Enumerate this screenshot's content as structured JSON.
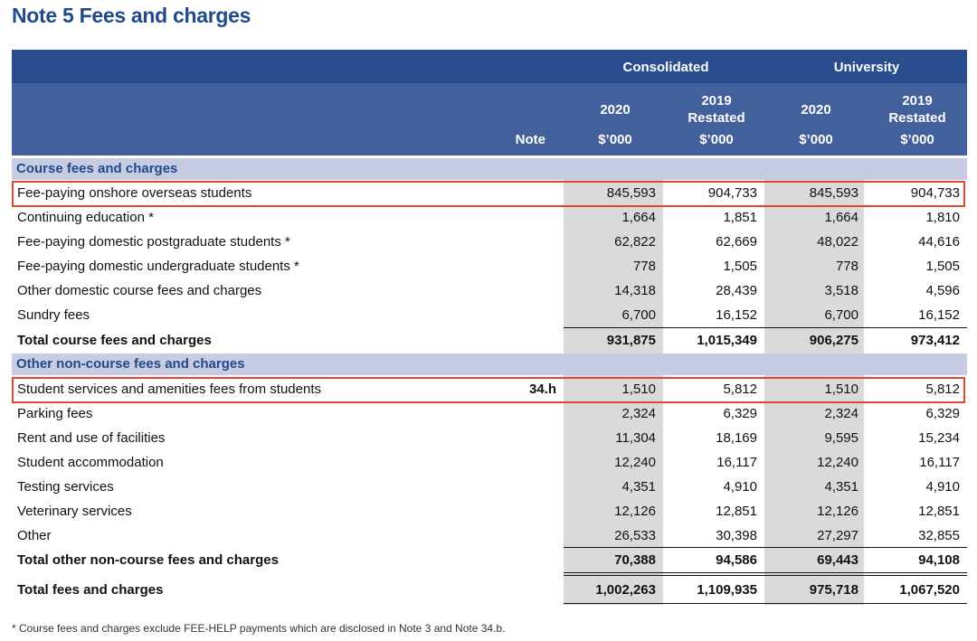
{
  "title": "Note 5 Fees and charges",
  "header": {
    "group_consolidated": "Consolidated",
    "group_university": "University",
    "note_label": "Note",
    "col_2020": "2020",
    "col_2019": "2019",
    "restated": "Restated",
    "unit": "$’000"
  },
  "sections": {
    "course": {
      "heading": "Course fees and charges",
      "rows": [
        {
          "label": "Fee-paying onshore overseas students",
          "note": "",
          "values": [
            "845,593",
            "904,733",
            "845,593",
            "904,733"
          ]
        },
        {
          "label": "Continuing education *",
          "note": "",
          "values": [
            "1,664",
            "1,851",
            "1,664",
            "1,810"
          ]
        },
        {
          "label": "Fee-paying domestic postgraduate students *",
          "note": "",
          "values": [
            "62,822",
            "62,669",
            "48,022",
            "44,616"
          ]
        },
        {
          "label": "Fee-paying domestic undergraduate students *",
          "note": "",
          "values": [
            "778",
            "1,505",
            "778",
            "1,505"
          ]
        },
        {
          "label": "Other domestic course fees and charges",
          "note": "",
          "values": [
            "14,318",
            "28,439",
            "3,518",
            "4,596"
          ]
        },
        {
          "label": "Sundry fees",
          "note": "",
          "values": [
            "6,700",
            "16,152",
            "6,700",
            "16,152"
          ]
        }
      ],
      "total": {
        "label": "Total course fees and charges",
        "values": [
          "931,875",
          "1,015,349",
          "906,275",
          "973,412"
        ]
      }
    },
    "other": {
      "heading": "Other non-course fees and charges",
      "rows": [
        {
          "label": "Student services and amenities fees from students",
          "note": "34.h",
          "values": [
            "1,510",
            "5,812",
            "1,510",
            "5,812"
          ]
        },
        {
          "label": "Parking fees",
          "note": "",
          "values": [
            "2,324",
            "6,329",
            "2,324",
            "6,329"
          ]
        },
        {
          "label": "Rent and use of facilities",
          "note": "",
          "values": [
            "11,304",
            "18,169",
            "9,595",
            "15,234"
          ]
        },
        {
          "label": "Student accommodation",
          "note": "",
          "values": [
            "12,240",
            "16,117",
            "12,240",
            "16,117"
          ]
        },
        {
          "label": "Testing services",
          "note": "",
          "values": [
            "4,351",
            "4,910",
            "4,351",
            "4,910"
          ]
        },
        {
          "label": "Veterinary services",
          "note": "",
          "values": [
            "12,126",
            "12,851",
            "12,126",
            "12,851"
          ]
        },
        {
          "label": "Other",
          "note": "",
          "values": [
            "26,533",
            "30,398",
            "27,297",
            "32,855"
          ]
        }
      ],
      "total": {
        "label": "Total other non-course fees and charges",
        "values": [
          "70,388",
          "94,586",
          "69,443",
          "94,108"
        ]
      }
    }
  },
  "grand_total": {
    "label": "Total fees and charges",
    "values": [
      "1,002,263",
      "1,109,935",
      "975,718",
      "1,067,520"
    ]
  },
  "footnote": "* Course fees and charges exclude FEE-HELP payments which are disclosed in Note 3 and Note 34.b.",
  "colors": {
    "header_dark": "#2a4d8f",
    "header_light": "#42609b",
    "section_band": "#c7cce3",
    "highlight": "#e0472e",
    "title": "#1f4a8c"
  }
}
